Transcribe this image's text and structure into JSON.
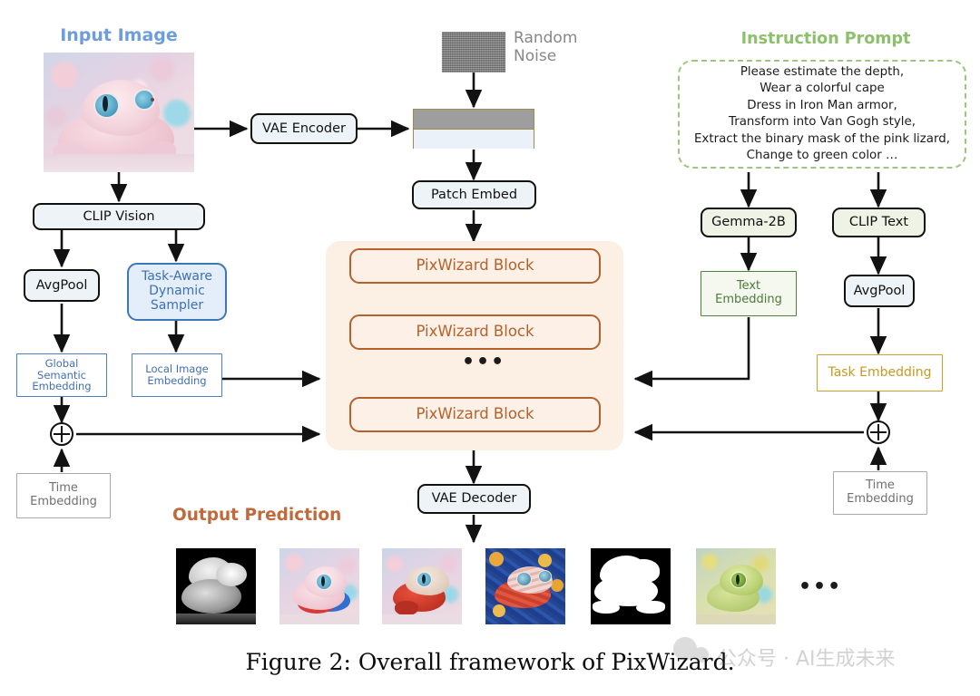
{
  "figure": {
    "caption": "Figure 2: Overall framework of PixWizard.",
    "watermark": "公众号 · AI生成未来"
  },
  "sections": {
    "input_image_title": "Input Image",
    "instruction_prompt_title": "Instruction Prompt",
    "output_prediction_title": "Output Prediction",
    "random_noise_label": "Random Noise"
  },
  "nodes": {
    "vae_encoder": "VAE Encoder",
    "patch_embed": "Patch Embed",
    "vae_decoder": "VAE Decoder",
    "clip_vision": "CLIP Vision",
    "avgpool_left": "AvgPool",
    "task_aware_dynamic_sampler": "Task-Aware\nDynamic\nSampler",
    "global_semantic_embedding": "Global\nSemantic\nEmbedding",
    "local_image_embedding": "Local Image\nEmbedding",
    "time_embedding_left": "Time\nEmbedding",
    "time_embedding_right": "Time\nEmbedding",
    "gemma_2b": "Gemma-2B",
    "clip_text": "CLIP Text",
    "text_embedding": "Text\nEmbedding",
    "avgpool_right": "AvgPool",
    "task_embedding": "Task Embedding",
    "pixwizard_block_1": "PixWizard Block",
    "pixwizard_block_2": "PixWizard Block",
    "pixwizard_block_n": "PixWizard Block",
    "block_ellipsis": "•••",
    "output_ellipsis": "•••"
  },
  "prompt": {
    "lines": [
      "Please estimate the depth,",
      "Wear a colorful cape",
      "Dress in Iron Man armor,",
      "Transform into Van Gogh style,",
      "Extract the binary mask of the pink lizard,",
      "Change to green color …"
    ]
  },
  "outputs": [
    {
      "name": "depth-map"
    },
    {
      "name": "colorful-cape-lizard"
    },
    {
      "name": "iron-man-armor-lizard"
    },
    {
      "name": "van-gogh-style-lizard"
    },
    {
      "name": "binary-mask"
    },
    {
      "name": "green-color-lizard"
    }
  ],
  "colors": {
    "accent_blue": "#6d9ddb",
    "accent_green": "#8cc06a",
    "accent_orange": "#c1693a",
    "block_border": "#b4622c",
    "block_panel": "#fcefe4",
    "gold": "#c9a227",
    "green_box": "#4f7f3c",
    "gray": "#a9a9a9"
  }
}
